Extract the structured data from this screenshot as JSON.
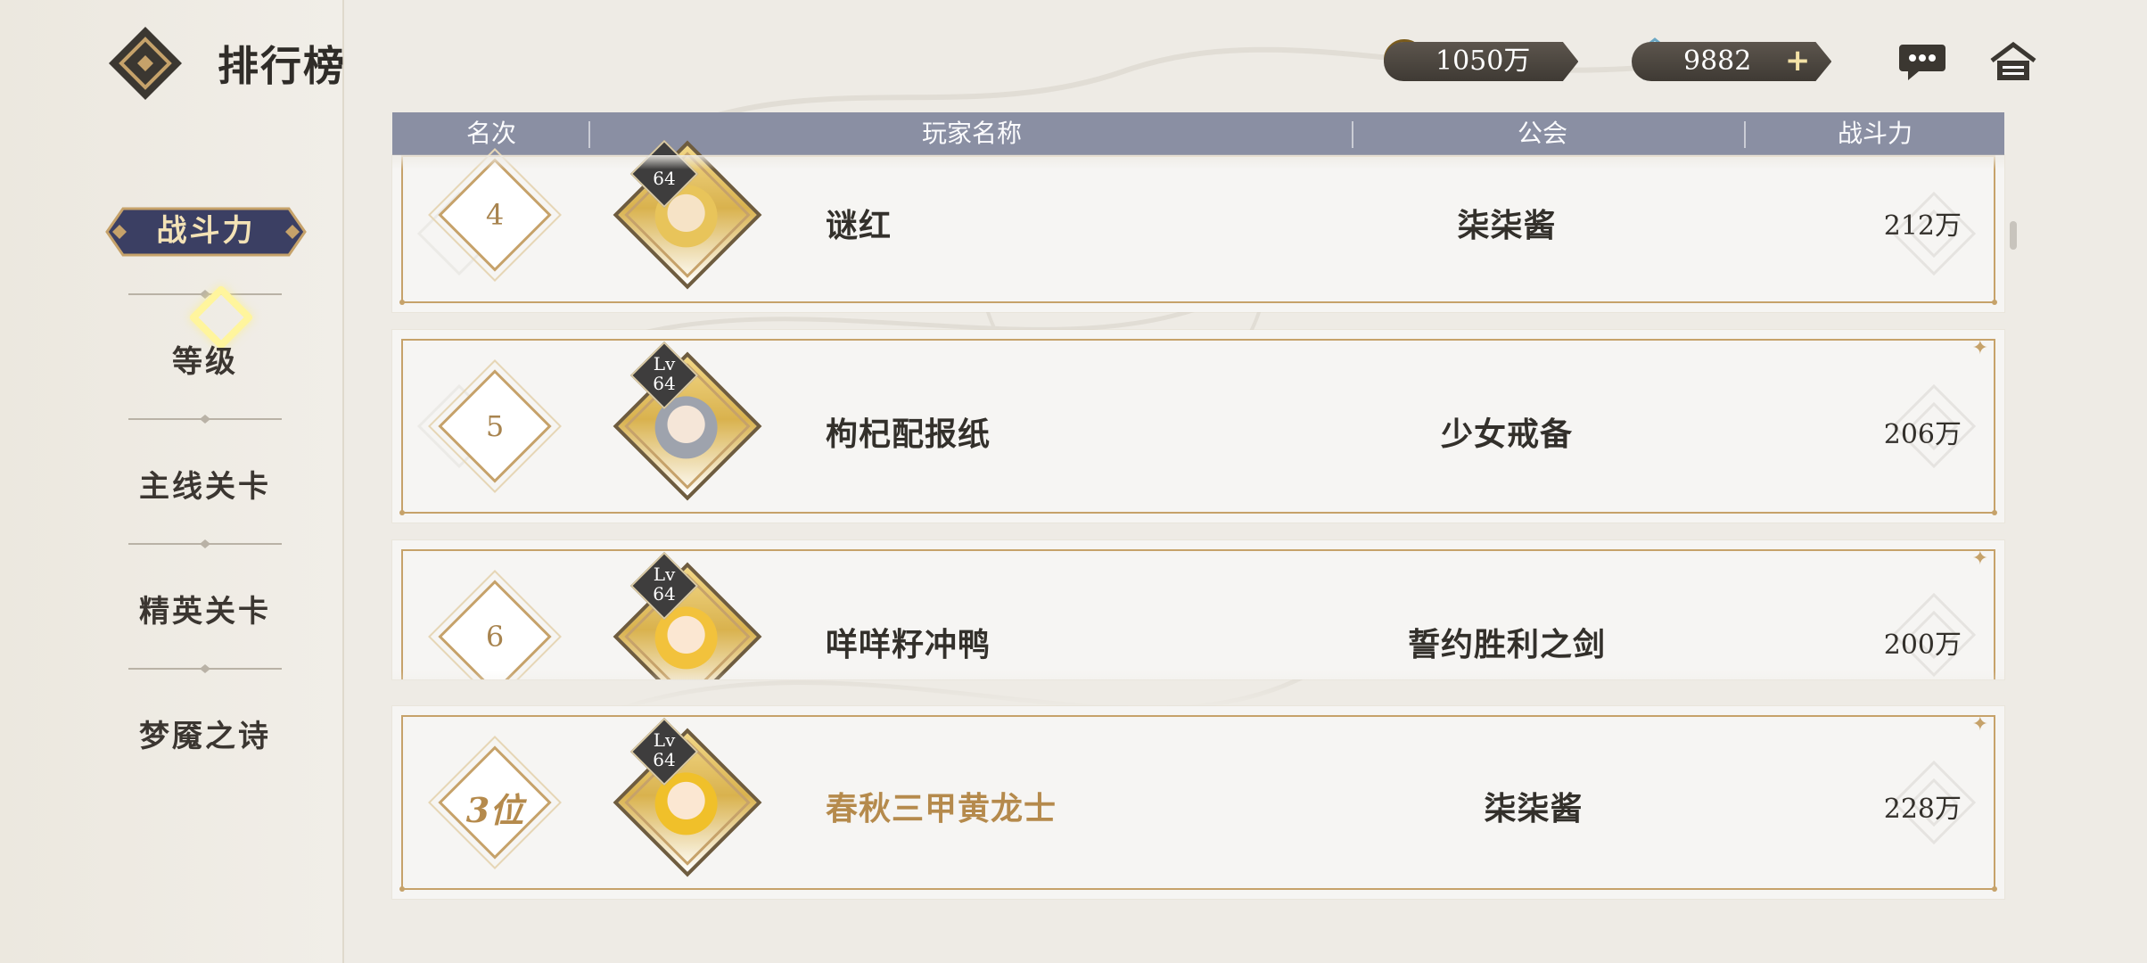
{
  "header": {
    "title": "排行榜",
    "gold_amount": "1050万",
    "gem_amount": "9882",
    "gem_add_symbol": "+"
  },
  "menu": {
    "items": [
      {
        "label": "战斗力",
        "active": true
      },
      {
        "label": "等级",
        "active": false
      },
      {
        "label": "主线关卡",
        "active": false
      },
      {
        "label": "精英关卡",
        "active": false
      },
      {
        "label": "梦魇之诗",
        "active": false
      }
    ]
  },
  "table": {
    "columns": [
      "名次",
      "玩家名称",
      "公会",
      "战斗力"
    ],
    "rows": [
      {
        "rank": "4",
        "level_prefix": "",
        "level": "64",
        "name": "谜红",
        "guild": "柒柒酱",
        "power": "212万"
      },
      {
        "rank": "5",
        "level_prefix": "Lv",
        "level": "64",
        "name": "枸杞配报纸",
        "guild": "少女戒备",
        "power": "206万"
      },
      {
        "rank": "6",
        "level_prefix": "Lv",
        "level": "64",
        "name": "咩咩籽冲鸭",
        "guild": "誓约胜利之剑",
        "power": "200万"
      }
    ],
    "self_row": {
      "rank": "3位",
      "level_prefix": "Lv",
      "level": "64",
      "name": "春秋三甲黄龙士",
      "guild": "柒柒酱",
      "power": "228万"
    }
  },
  "colors": {
    "gold_accent": "#c6a26a",
    "header_bar": "#8a8fa3",
    "active_tab": "#3b3f63",
    "self_name": "#b58a4c"
  },
  "icons": [
    "logo-icon",
    "coin-icon",
    "gem-icon",
    "chat-icon",
    "home-icon"
  ]
}
